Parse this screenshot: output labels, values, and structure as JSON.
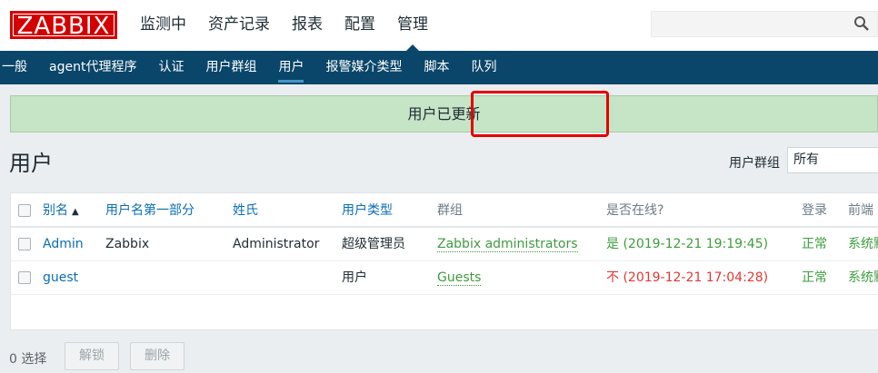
{
  "brand": {
    "logo_text": "ZABBIX"
  },
  "main_nav": [
    {
      "label": "监测中"
    },
    {
      "label": "资产记录"
    },
    {
      "label": "报表"
    },
    {
      "label": "配置"
    },
    {
      "label": "管理",
      "active": true
    }
  ],
  "search": {
    "value": "",
    "placeholder": ""
  },
  "sub_nav": [
    {
      "label": "一般"
    },
    {
      "label": "agent代理程序"
    },
    {
      "label": "认证"
    },
    {
      "label": "用户群组"
    },
    {
      "label": "用户",
      "active": true
    },
    {
      "label": "报警媒介类型"
    },
    {
      "label": "脚本"
    },
    {
      "label": "队列"
    }
  ],
  "message": {
    "text": "用户已更新"
  },
  "page": {
    "title": "用户"
  },
  "filter": {
    "label": "用户群组",
    "selected": "所有"
  },
  "table": {
    "columns": {
      "alias": "别名",
      "sort_indicator": "▲",
      "name": "用户名第一部分",
      "surname": "姓氏",
      "user_type": "用户类型",
      "groups": "群组",
      "online": "是否在线?",
      "login": "登录",
      "frontend": "前端"
    },
    "rows": [
      {
        "alias": "Admin",
        "name": "Zabbix",
        "surname": "Administrator",
        "user_type": "超级管理员",
        "groups": "Zabbix administrators",
        "online": "是 (2019-12-21 19:19:45)",
        "login": "正常",
        "frontend": "系统默"
      },
      {
        "alias": "guest",
        "name": "",
        "surname": "",
        "user_type": "用户",
        "groups": "Guests",
        "online": "不 (2019-12-21 17:04:28)",
        "login": "正常",
        "frontend": "系统默"
      }
    ]
  },
  "footer": {
    "selected_count": "0 选择",
    "unlock_label": "解锁",
    "delete_label": "删除"
  },
  "colors": {
    "header_bg": "#ffffff",
    "subnav_bg": "#0a466a",
    "logo_red": "#d40000",
    "success_bg": "#c6e4c6",
    "online_green": "#3c9e3c",
    "offline_red": "#e33734",
    "link_blue": "#0a6eb4",
    "highlight_red": "#e40000"
  }
}
